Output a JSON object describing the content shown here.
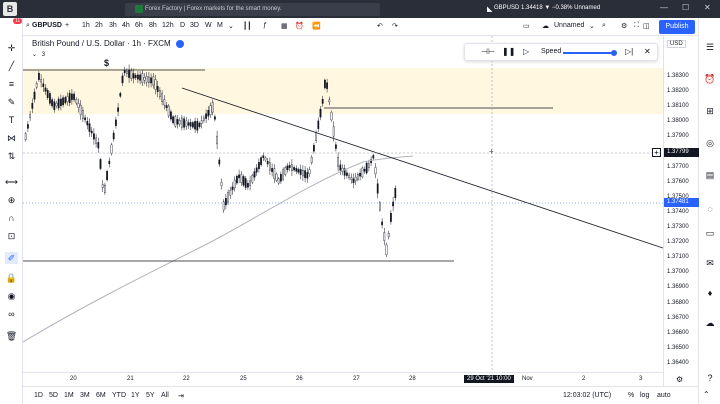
{
  "titlebar": {
    "tab_title": "Forex Factory | Forex markets for the smart money.",
    "window_title": "GBPUSD 1.34418 ▼ −0.38% Unnamed",
    "logo": "B"
  },
  "toolbar": {
    "symbol": "GBPUSD",
    "intervals": [
      "1h",
      "2h",
      "3h",
      "4h",
      "6h",
      "8h",
      "12h",
      "D",
      "3D",
      "W",
      "M"
    ],
    "layout_name": "Unnamed",
    "publish_label": "Publish"
  },
  "legend": {
    "title": "British Pound / U.S. Dollar · 1h · FXCM",
    "badge": "3"
  },
  "replay": {
    "speed_label": "Speed"
  },
  "price_scale": {
    "currency": "USD",
    "labels": [
      "1.38300",
      "1.38200",
      "1.38100",
      "1.38000",
      "1.37900",
      "1.37800",
      "1.37700",
      "1.37600",
      "1.37500",
      "1.37400",
      "1.37300",
      "1.37200",
      "1.37100",
      "1.37000",
      "1.36900",
      "1.36800",
      "1.36700",
      "1.36600",
      "1.36500",
      "1.36400"
    ],
    "crosshair_price": "1.37799",
    "last_price": "1.37481"
  },
  "time_axis": {
    "labels": [
      "20",
      "21",
      "22",
      "25",
      "26",
      "27",
      "28",
      "Nov",
      "2",
      "3"
    ],
    "crosshair_time": "29 Oct '21   10:00"
  },
  "bottom": {
    "ranges": [
      "1D",
      "5D",
      "1M",
      "3M",
      "6M",
      "YTD",
      "1Y",
      "5Y",
      "All"
    ],
    "clock": "12:03:02 (UTC)",
    "pct": "%",
    "log": "log",
    "auto": "auto"
  },
  "colors": {
    "up": "#26a69a",
    "down": "#ef5350",
    "candle": "#131722",
    "accent": "#2962ff"
  }
}
